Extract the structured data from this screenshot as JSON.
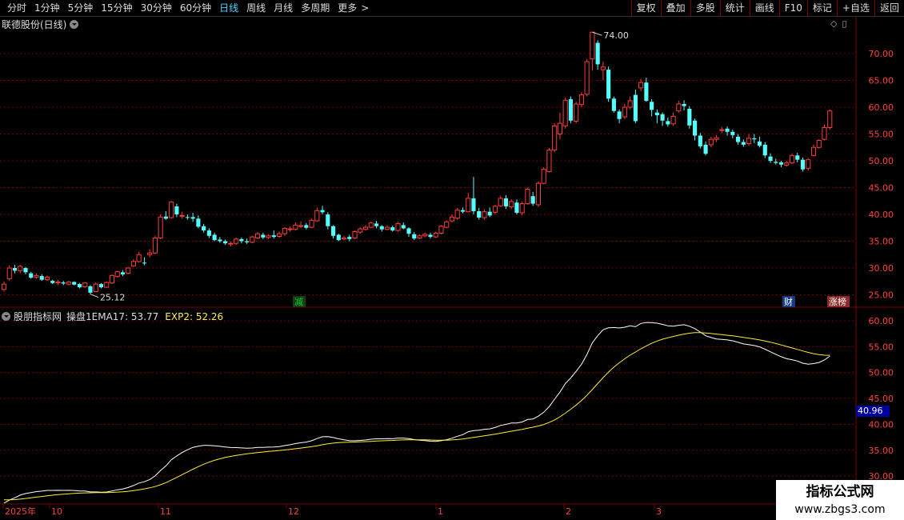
{
  "toolbar": {
    "periods": [
      "分时",
      "1分钟",
      "5分钟",
      "15分钟",
      "30分钟",
      "60分钟",
      "日线",
      "周线",
      "月线",
      "多周期",
      "更多"
    ],
    "active": "日线",
    "more_chevron": ">",
    "right_buttons": [
      "复权",
      "叠加",
      "多股",
      "统计",
      "画线",
      "F10",
      "标记",
      "+自选",
      "返回"
    ]
  },
  "stock_title": "联德股份(日线)",
  "indicator": {
    "name": "股朋指标网",
    "line1_label": "操盘1EMA17: 53.77",
    "line2_label": "EXP2: 52.26"
  },
  "markers": {
    "high": "74.00",
    "low": "25.12"
  },
  "event_tags": [
    {
      "text": "减",
      "color": "#00cc44",
      "bg": "#1a3d10"
    },
    {
      "text": "财",
      "color": "#ffffff",
      "bg": "#1a3a80"
    },
    {
      "text": "涨榜",
      "color": "#ffffff",
      "bg": "#8a2a2a"
    }
  ],
  "price_axis": [
    "70.00",
    "65.00",
    "60.00",
    "55.00",
    "50.00",
    "45.00",
    "40.00",
    "35.00",
    "30.00",
    "25.00"
  ],
  "ind_axis": [
    "60.00",
    "55.00",
    "50.00",
    "45.00",
    "40.00",
    "35.00",
    "30.00"
  ],
  "price_box": "40.96",
  "time_axis": [
    "2025年",
    "10",
    "11",
    "12",
    "1",
    "2",
    "3"
  ],
  "watermark": {
    "line1": "指标公式网",
    "line2": "www.zbgs3.com"
  },
  "colors": {
    "up": "#ff3b3b",
    "down": "#54ffff",
    "ema": "#ffffff",
    "exp2": "#ffee33",
    "grid": "#7a0000",
    "axis_text": "#ff4040"
  }
}
